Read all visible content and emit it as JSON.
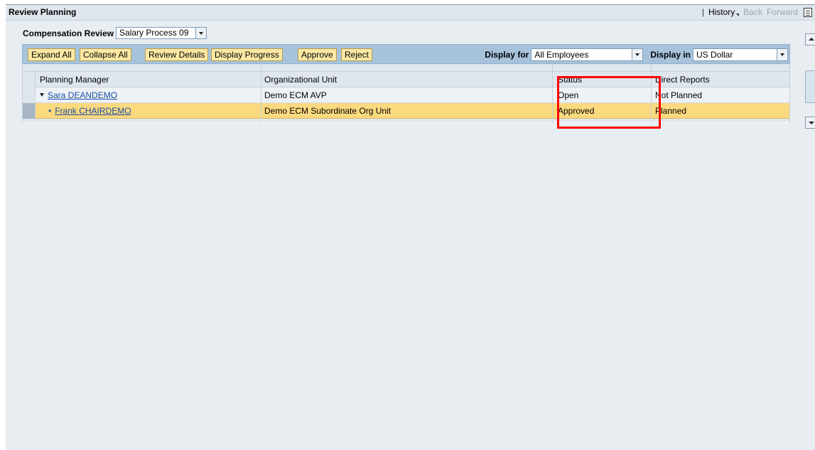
{
  "header": {
    "title": "Review Planning",
    "nav_separator": "|",
    "history": "History",
    "back": "Back",
    "forward": "Forward"
  },
  "filters": {
    "compensation_review_label": "Compensation Review",
    "compensation_review_value": "Salary Process 09"
  },
  "toolbar": {
    "expand_all": "Expand All",
    "collapse_all": "Collapse All",
    "review_details": "Review Details",
    "display_progress": "Display Progress",
    "approve": "Approve",
    "reject": "Reject",
    "display_for_label": "Display for",
    "display_for_value": "All Employees",
    "display_in_label": "Display in",
    "display_in_value": "US Dollar"
  },
  "table": {
    "columns": [
      "Planning Manager",
      "Organizational Unit",
      "Status",
      "Direct Reports"
    ],
    "rows": [
      {
        "manager": "Sara DEANDEMO",
        "org_unit": "Demo ECM AVP",
        "status": "Open",
        "direct_reports": "Not Planned"
      },
      {
        "manager": "Frank CHAIRDEMO",
        "org_unit": "Demo ECM Subordinate Org Unit",
        "status": "Approved",
        "direct_reports": "Planned"
      }
    ]
  },
  "colors": {
    "highlight_box": "#ff0000",
    "selected_row": "#fbd97f",
    "toolbar_bg": "#a7c3dc",
    "button_bg": "#fce8a4",
    "link": "#1a4fa3"
  }
}
